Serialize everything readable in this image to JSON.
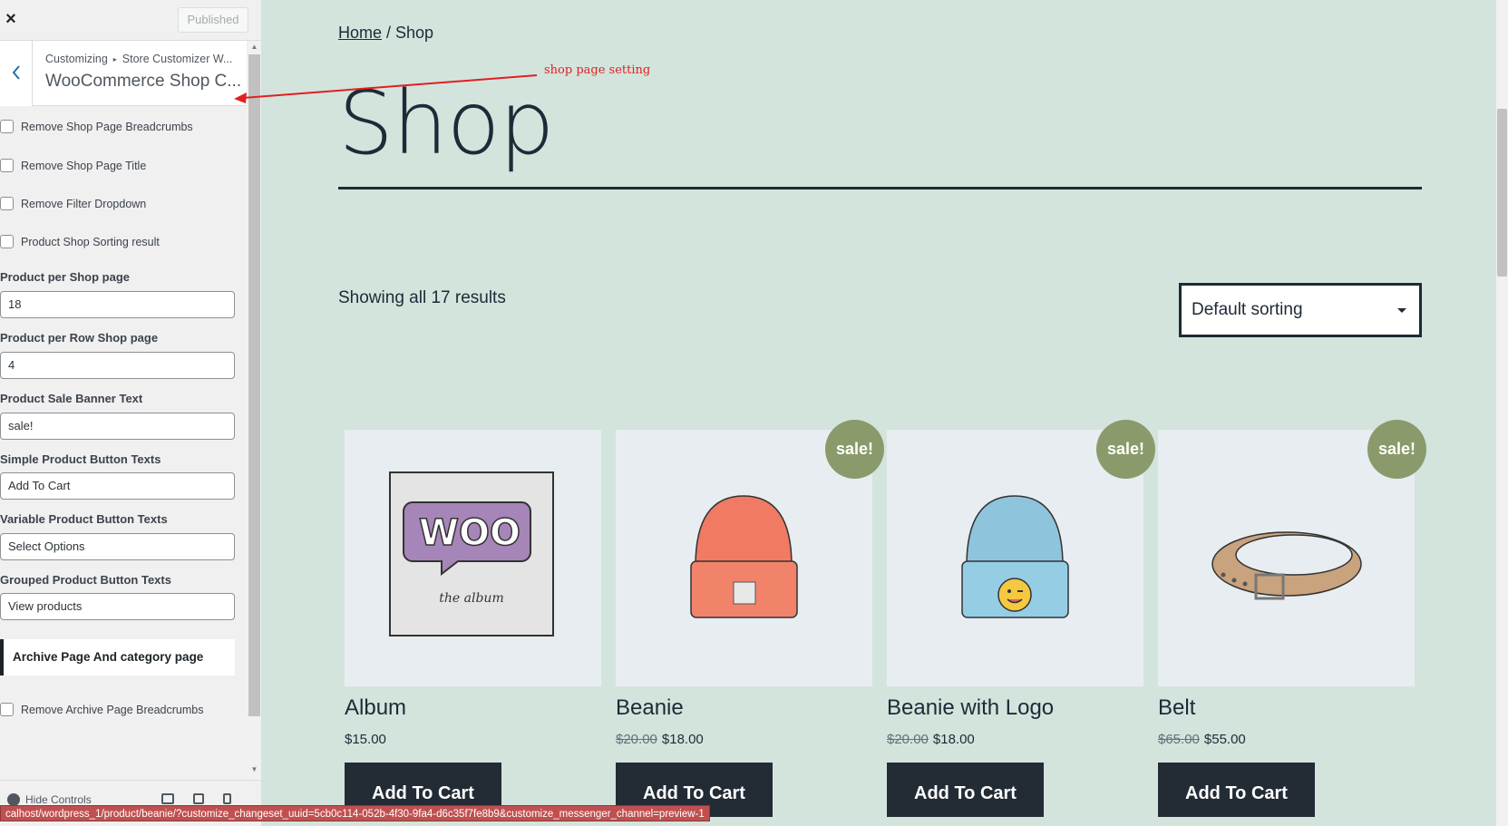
{
  "sidebar": {
    "close_icon": "×",
    "published_label": "Published",
    "breadcrumb": {
      "root": "Customizing",
      "separator": "▸",
      "parent": "Store Customizer W..."
    },
    "section_title": "WooCommerce Shop C...",
    "checkboxes": [
      {
        "label": "Remove Shop Page Breadcrumbs",
        "checked": false
      },
      {
        "label": "Remove Shop Page Title",
        "checked": false
      },
      {
        "label": "Remove Filter Dropdown",
        "checked": false
      },
      {
        "label": "Product Shop Sorting result",
        "checked": false
      }
    ],
    "fields": [
      {
        "label": "Product per Shop page",
        "value": "18"
      },
      {
        "label": "Product per Row Shop page",
        "value": "4"
      },
      {
        "label": "Product Sale Banner Text",
        "value": "sale!"
      },
      {
        "label": "Simple Product Button Texts",
        "value": "Add To Cart"
      },
      {
        "label": "Variable Product Button Texts",
        "value": "Select Options"
      },
      {
        "label": "Grouped Product Button Texts",
        "value": "View products"
      }
    ],
    "archive_section_title": "Archive Page And category page",
    "archive_checkbox": {
      "label": "Remove Archive Page Breadcrumbs",
      "checked": false
    },
    "footer": {
      "hide_controls_label": "Hide Controls"
    }
  },
  "status_url": "calhost/wordpress_1/product/beanie/?customize_changeset_uuid=5cb0c114-052b-4f30-9fa4-d6c35f7fe8b9&customize_messenger_channel=preview-1",
  "annotation": {
    "text": "shop page setting",
    "color": "#e02020"
  },
  "preview": {
    "breadcrumb": {
      "home": "Home",
      "separator": " / ",
      "current": "Shop"
    },
    "page_title": "Shop",
    "result_count": "Showing all 17 results",
    "sort_selected": "Default sorting",
    "products": [
      {
        "name": "Album",
        "old_price": "",
        "price": "$15.00",
        "sale": false,
        "button": "Add To Cart",
        "image": "album-icon"
      },
      {
        "name": "Beanie",
        "old_price": "$20.00",
        "price": "$18.00",
        "sale": true,
        "button": "Add To Cart",
        "image": "beanie-icon"
      },
      {
        "name": "Beanie with Logo",
        "old_price": "$20.00",
        "price": "$18.00",
        "sale": true,
        "button": "Add To Cart",
        "image": "beanie-logo-icon"
      },
      {
        "name": "Belt",
        "old_price": "$65.00",
        "price": "$55.00",
        "sale": true,
        "button": "Add To Cart",
        "image": "belt-icon"
      }
    ],
    "sale_badge_text": "sale!"
  },
  "colors": {
    "preview_bg": "#d3e4dd",
    "text_dark": "#1e2a37",
    "sale_badge": "#8a9a6a",
    "button_bg": "#232b35",
    "accent_blue": "#2271b1"
  }
}
